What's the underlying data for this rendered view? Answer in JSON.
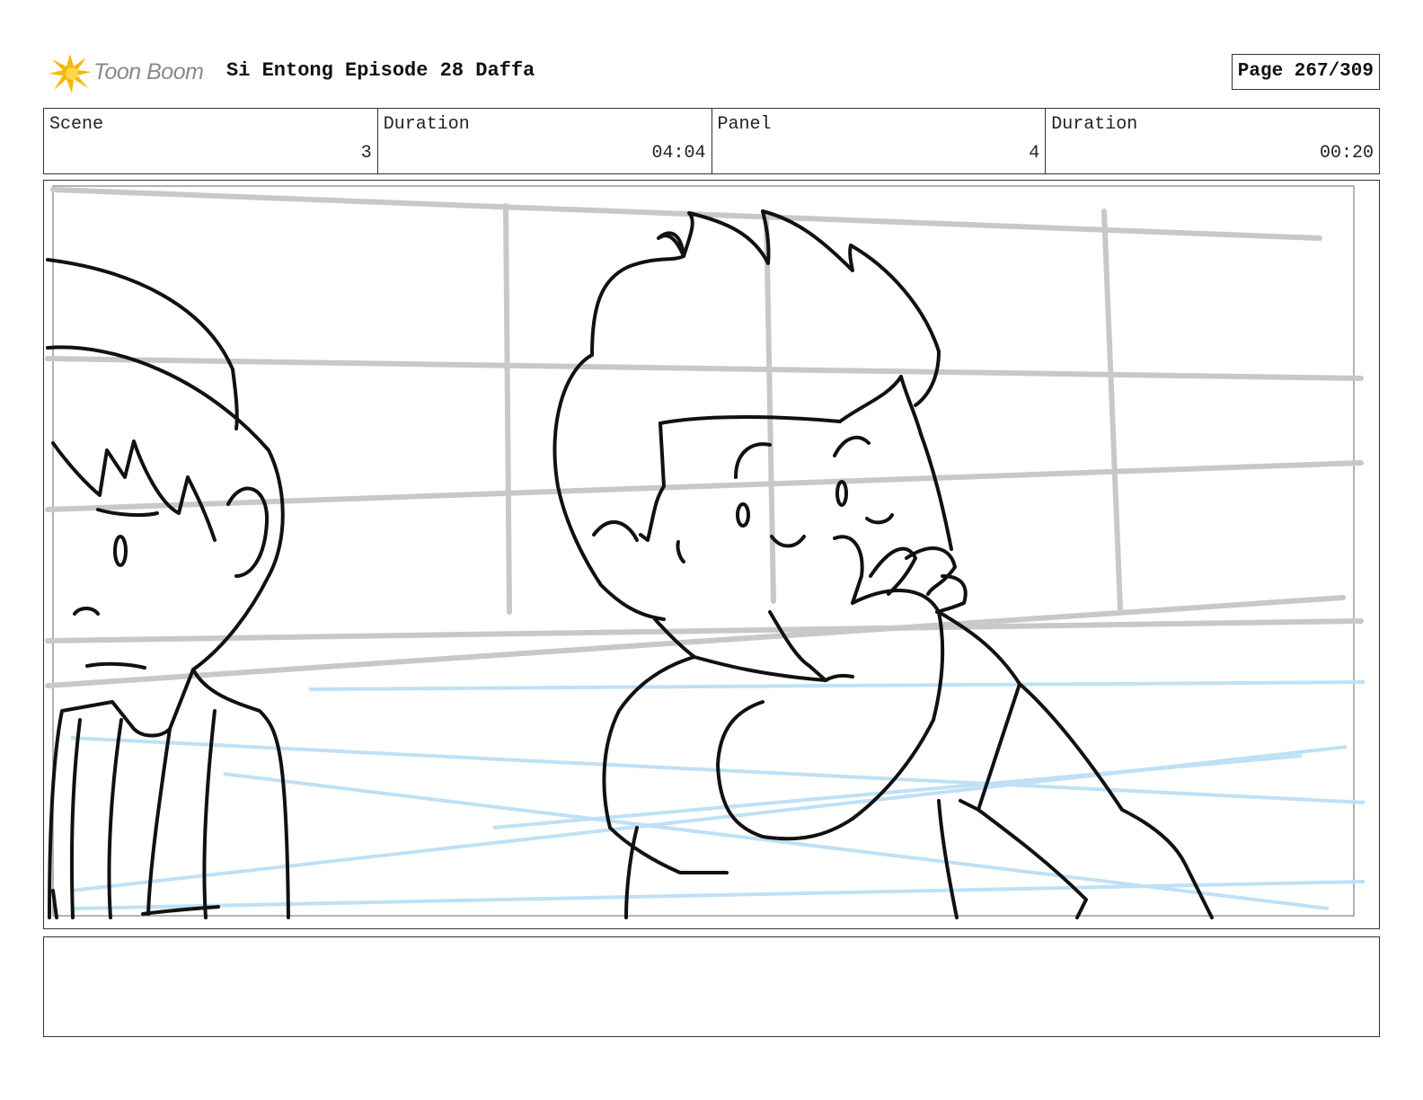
{
  "header": {
    "logo_text": "Toon Boom",
    "title": "Si Entong Episode 28 Daffa",
    "page": "Page 267/309"
  },
  "info": {
    "scene_label": "Scene",
    "scene_value": "3",
    "scene_duration_label": "Duration",
    "scene_duration_value": "04:04",
    "panel_label": "Panel",
    "panel_value": "4",
    "panel_duration_label": "Duration",
    "panel_duration_value": "00:20"
  },
  "caption": {
    "text": ""
  },
  "colors": {
    "logo_accent": "#f6b800",
    "guide_lines": "#c8c8c8",
    "perspective_lines": "#bfe0f5"
  }
}
